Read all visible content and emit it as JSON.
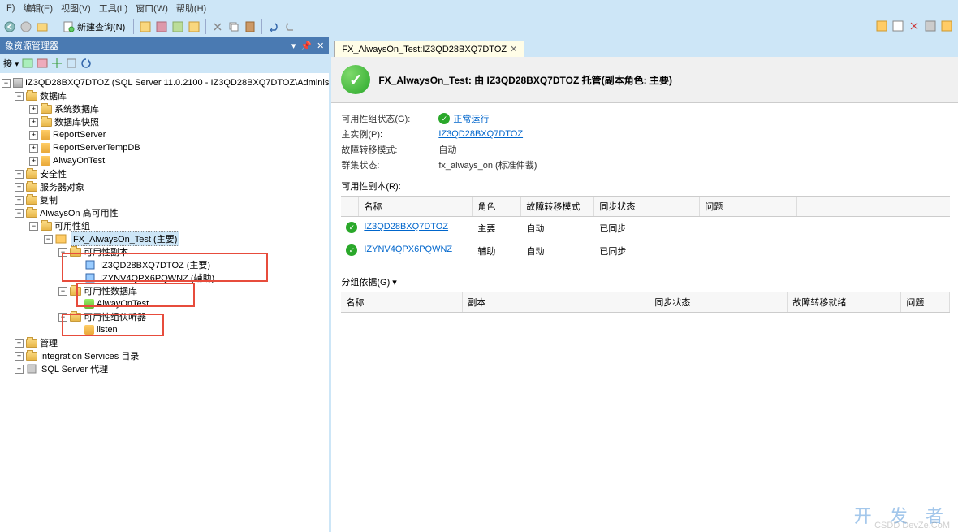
{
  "menu": {
    "file": "F",
    "edit": "编辑(E)",
    "view": "视图(V)",
    "tools": "工具(L)",
    "window": "窗口(W)",
    "help": "帮助(H)"
  },
  "toolbar": {
    "new_query": "新建查询(N)"
  },
  "panel": {
    "title": "象资源管理器",
    "connect": "接 ▾",
    "root": "IZ3QD28BXQ7DTOZ (SQL Server 11.0.2100 - IZ3QD28BXQ7DTOZ\\Adminis",
    "databases": "数据库",
    "sys_db": "系统数据库",
    "db_snapshot": "数据库快照",
    "report_server": "ReportServer",
    "report_temp": "ReportServerTempDB",
    "alway_on_test": "AlwayOnTest",
    "security": "安全性",
    "server_objects": "服务器对象",
    "replication": "复制",
    "alwayson_ha": "AlwaysOn 高可用性",
    "ag": "可用性组",
    "fx_test": "FX_AlwaysOn_Test (主要)",
    "replicas": "可用性副本",
    "replica1": "IZ3QD28BXQ7DTOZ (主要)",
    "replica2": "IZYNV4QPX6PQWNZ (辅助)",
    "ag_db": "可用性数据库",
    "ag_db_item": "AlwayOnTest",
    "listeners": "可用性组伙听器",
    "listener": "listen",
    "management": "管理",
    "integration": "Integration Services 目录",
    "agent": "SQL Server 代理"
  },
  "tab": {
    "tab1": "FX_AlwaysOn_Test:IZ3QD28BXQ7DTOZ"
  },
  "dashboard": {
    "title": "FX_AlwaysOn_Test: 由 IZ3QD28BXQ7DTOZ 托管(副本角色: 主要)",
    "ag_state_label": "可用性组状态(G):",
    "ag_state_value": "正常运行",
    "primary_label": "主实例(P):",
    "primary_value": "IZ3QD28BXQ7DTOZ",
    "failover_mode_label": "故障转移模式:",
    "failover_mode_value": "自动",
    "cluster_label": "群集状态:",
    "cluster_value": "fx_always_on (标准仲裁)",
    "replicas_title": "可用性副本(R):",
    "cols": {
      "name": "名称",
      "role": "角色",
      "failover": "故障转移模式",
      "sync": "同步状态",
      "issue": "问题"
    },
    "rows": [
      {
        "name": "IZ3QD28BXQ7DTOZ",
        "role": "主要",
        "failover": "自动",
        "sync": "已同步"
      },
      {
        "name": "IZYNV4QPX6PQWNZ",
        "role": "辅助",
        "failover": "自动",
        "sync": "已同步"
      }
    ],
    "group_by": "分组依据(G) ▾",
    "gcols": {
      "name": "名称",
      "replica": "副本",
      "sync": "同步状态",
      "ready": "故障转移就绪",
      "issue": "问题"
    }
  },
  "watermark": "开 发 者",
  "watermark_sub": "CSDD DevZe.CoM"
}
